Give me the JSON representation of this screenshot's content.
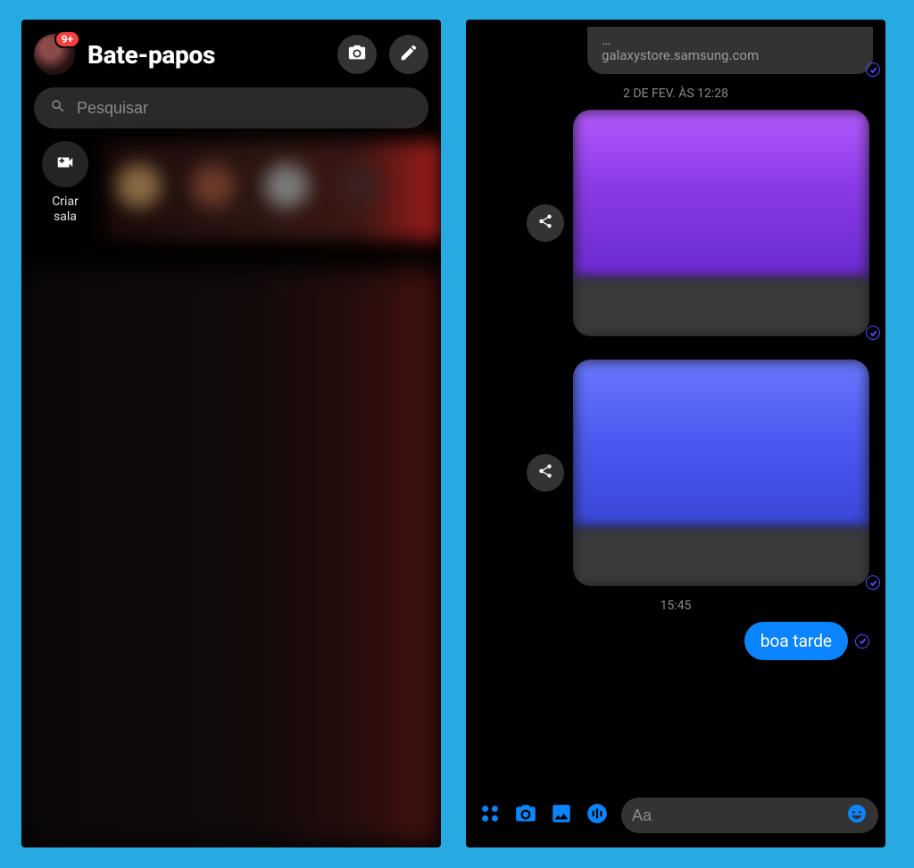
{
  "left": {
    "badge": "9+",
    "title": "Bate-papos",
    "search_placeholder": "Pesquisar",
    "create_room_label": "Criar\nsala"
  },
  "right": {
    "link_ellipsis": "…",
    "link_url": "galaxystore.samsung.com",
    "timestamp1": "2 DE FEV. ÀS 12:28",
    "timestamp2": "15:45",
    "message1": "boa tarde",
    "composer_placeholder": "Aa"
  }
}
